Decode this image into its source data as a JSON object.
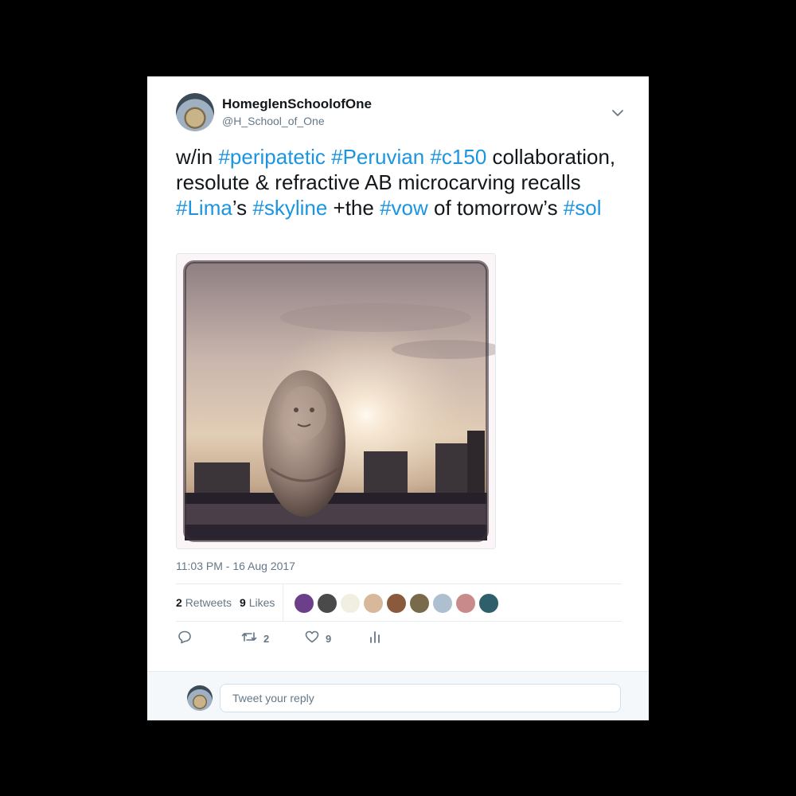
{
  "tweet": {
    "display_name": "HomeglenSchoolofOne",
    "handle": "@H_School_of_One",
    "text_segments": [
      {
        "t": "w/in ",
        "tag": false
      },
      {
        "t": "#peripatetic",
        "tag": true
      },
      {
        "t": " ",
        "tag": false
      },
      {
        "t": "#Peruvian",
        "tag": true
      },
      {
        "t": " ",
        "tag": false
      },
      {
        "t": "#c150",
        "tag": true
      },
      {
        "t": " collaboration, resolute & refractive AB microcarving recalls ",
        "tag": false
      },
      {
        "t": "#Lima",
        "tag": true
      },
      {
        "t": "’s ",
        "tag": false
      },
      {
        "t": "#skyline",
        "tag": true
      },
      {
        "t": " +the ",
        "tag": false
      },
      {
        "t": "#vow",
        "tag": true
      },
      {
        "t": " of tomorrow’s ",
        "tag": false
      },
      {
        "t": "#sol",
        "tag": true
      }
    ],
    "timestamp": "11:03 PM - 16 Aug 2017",
    "retweets_count": "2",
    "retweets_label": "Retweets",
    "likes_count": "9",
    "likes_label": "Likes",
    "action_retweet_count": "2",
    "action_like_count": "9"
  },
  "likers": [
    {
      "icon": "liker-avatar-1",
      "color": "#6b3f8a"
    },
    {
      "icon": "liker-avatar-2",
      "color": "#4a4a4a"
    },
    {
      "icon": "liker-avatar-3",
      "color": "#f1efe2"
    },
    {
      "icon": "liker-avatar-4",
      "color": "#d8b89a"
    },
    {
      "icon": "liker-avatar-5",
      "color": "#8a5a3c"
    },
    {
      "icon": "liker-avatar-6",
      "color": "#7a6a4c"
    },
    {
      "icon": "liker-avatar-7",
      "color": "#aebfd0"
    },
    {
      "icon": "liker-avatar-8",
      "color": "#c98a8a"
    },
    {
      "icon": "liker-avatar-9",
      "color": "#2f5f6a"
    }
  ],
  "reply": {
    "placeholder": "Tweet your reply"
  },
  "colors": {
    "hashtag": "#1b95e0",
    "text": "#14171a",
    "muted": "#657786"
  }
}
